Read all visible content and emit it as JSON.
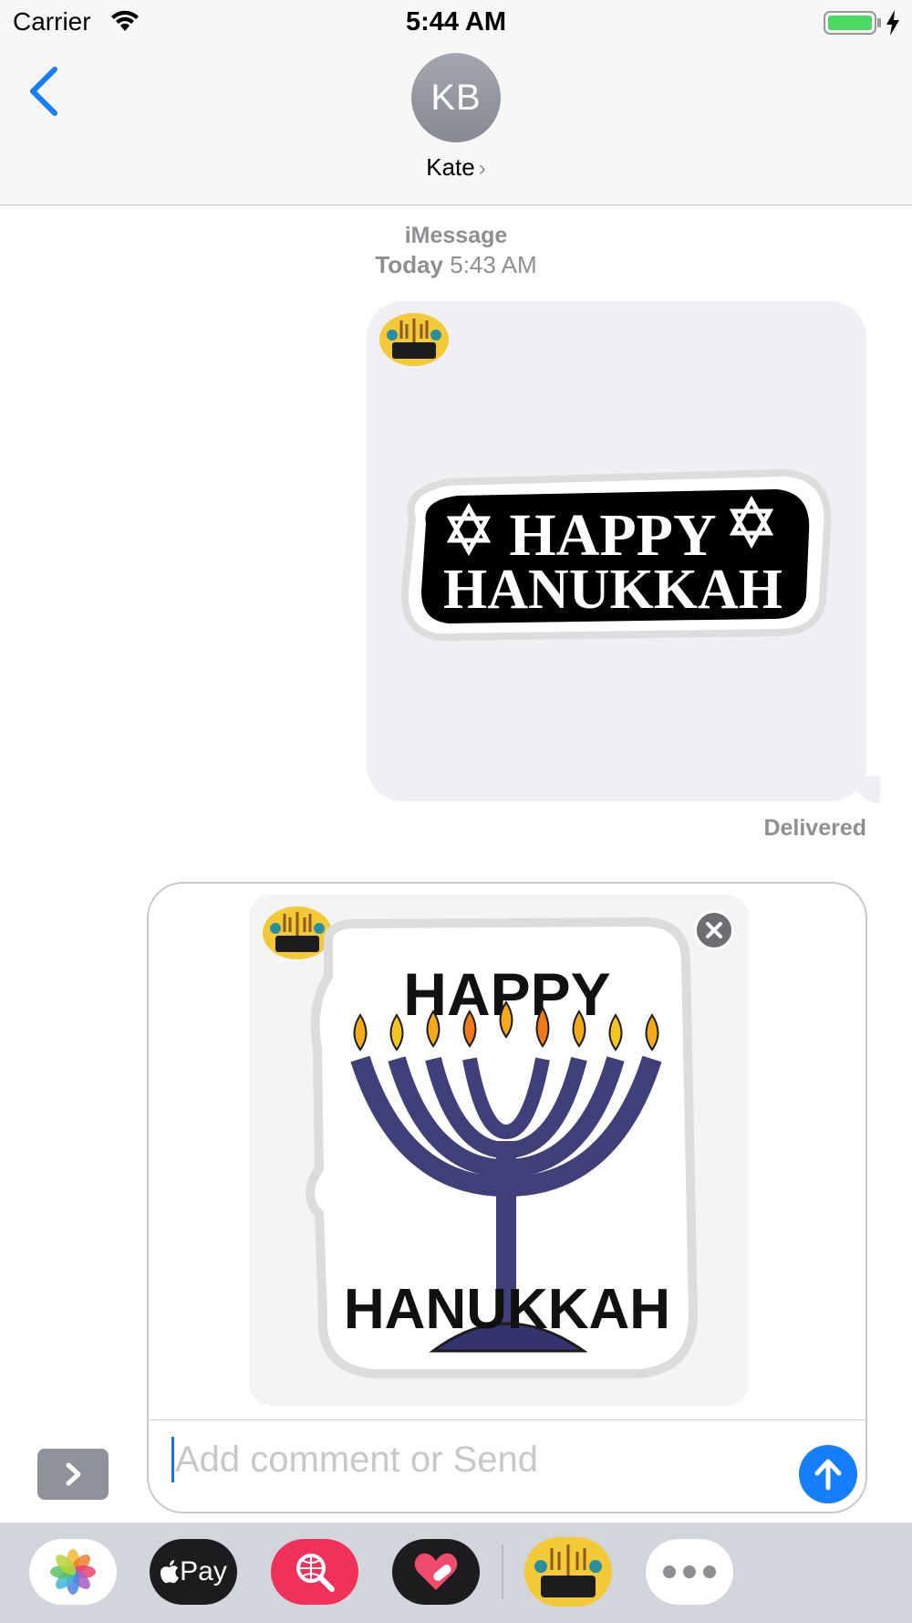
{
  "status_bar": {
    "carrier": "Carrier",
    "time": "5:44 AM",
    "battery_level": 1.0
  },
  "nav": {
    "avatar_initials": "KB",
    "contact_name": "Kate",
    "back_icon": "chevron-left-icon"
  },
  "conversation": {
    "service_label": "iMessage",
    "day_label": "Today",
    "time_label": "5:43 AM",
    "sent_sticker": {
      "line1": "HAPPY",
      "line2": "HANUKKAH"
    },
    "delivery_status": "Delivered"
  },
  "compose": {
    "staged_sticker": {
      "line1": "HAPPY",
      "line2": "HANUKKAH"
    },
    "placeholder": "Add comment or Send",
    "value": ""
  },
  "app_drawer": {
    "apps": [
      {
        "name": "Photos",
        "icon": "photos-icon"
      },
      {
        "name": "Apple Pay",
        "label": "Pay",
        "icon": "apple-pay-icon"
      },
      {
        "name": "Web Images",
        "icon": "globe-search-icon"
      },
      {
        "name": "Digital Touch",
        "icon": "heart-icon"
      },
      {
        "name": "Happy Hanukkah",
        "icon": "hanukkah-sticker-icon"
      },
      {
        "name": "More",
        "icon": "more-icon"
      }
    ]
  },
  "colors": {
    "accent": "#147efb",
    "bubble": "#efeff4",
    "secondary_text": "#8e8e93",
    "sticker_badge": "#f3c937",
    "menorah": "#3f3f7a",
    "flame": "#f2a91b"
  }
}
